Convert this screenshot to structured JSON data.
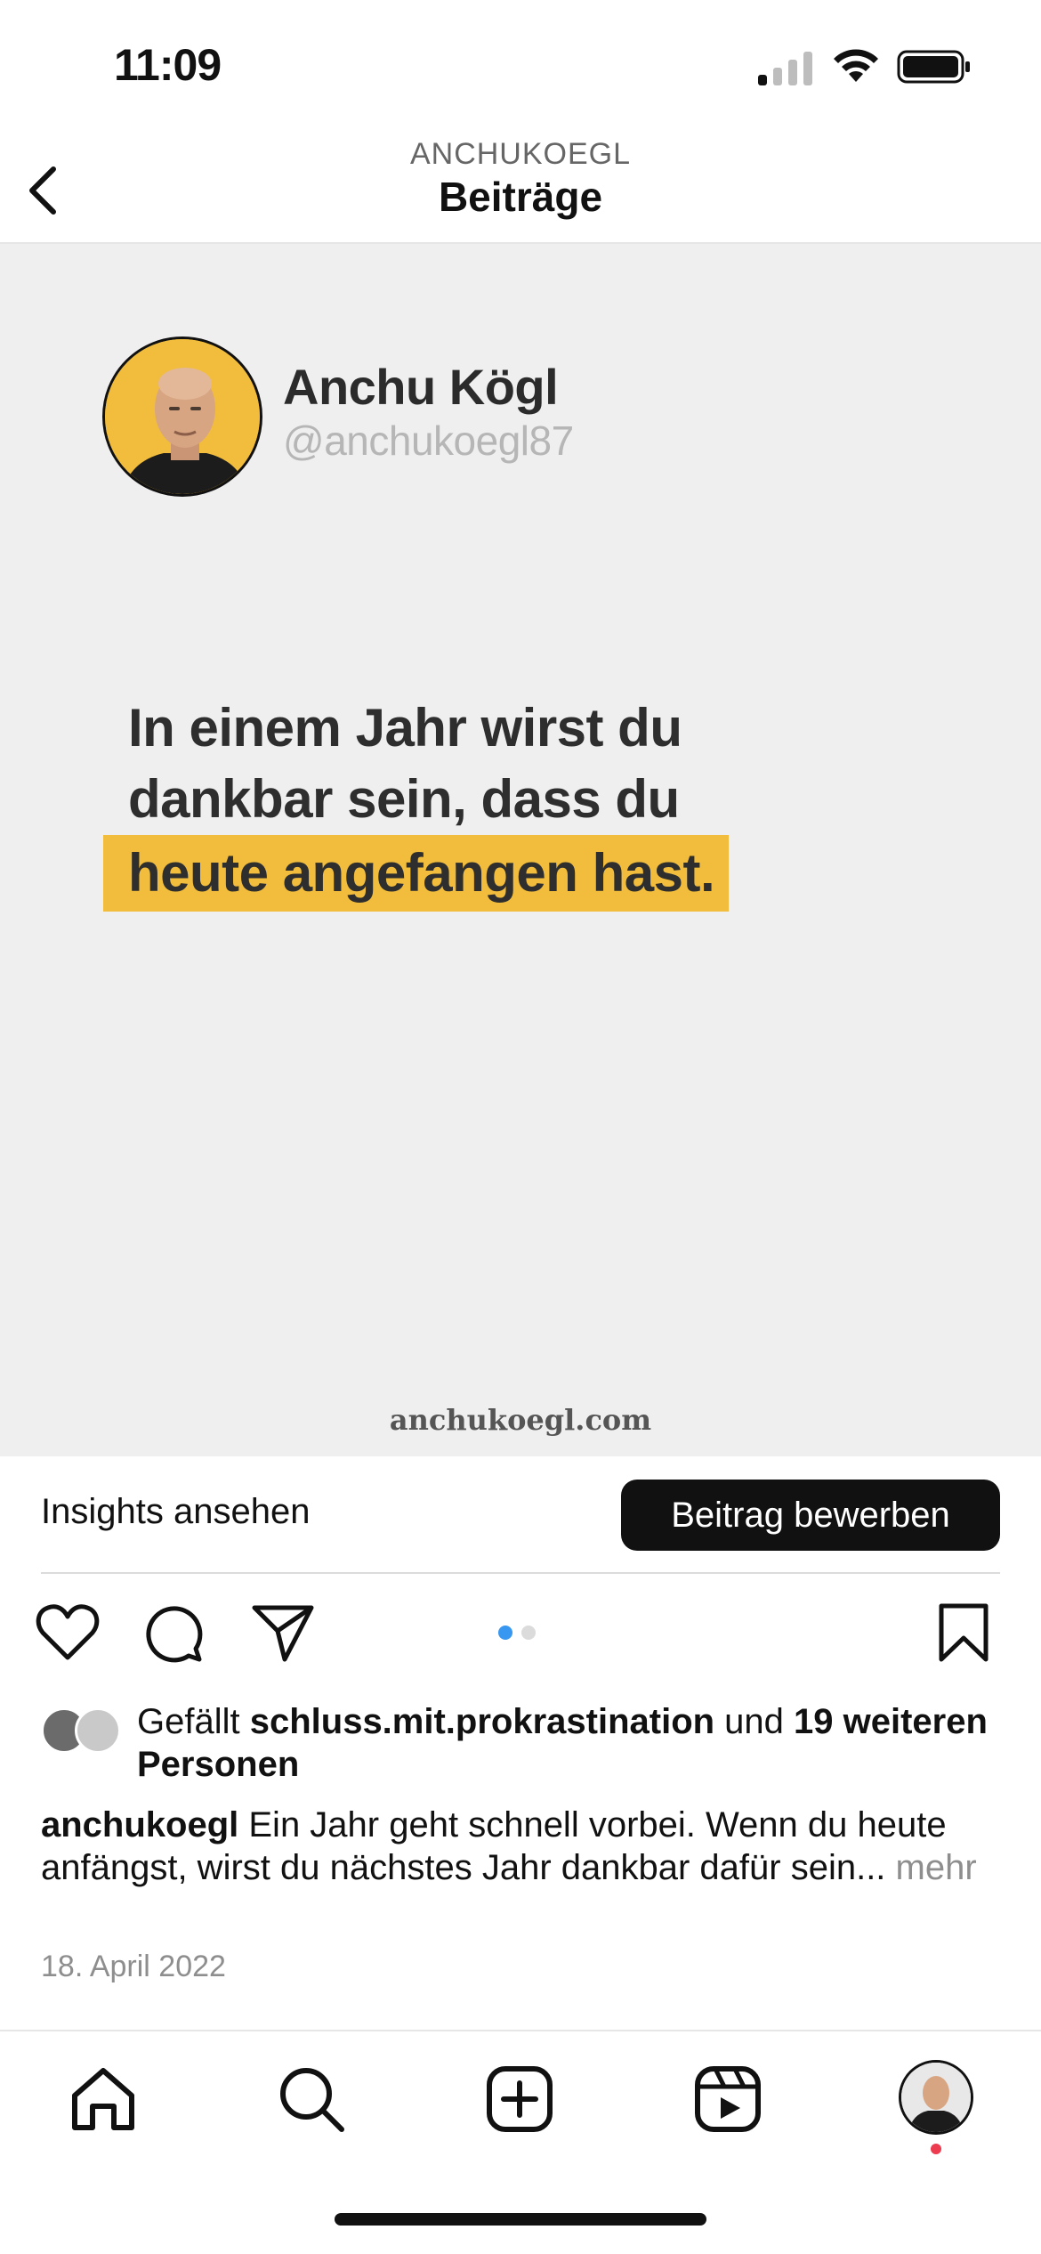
{
  "status_bar": {
    "time": "11:09"
  },
  "header": {
    "username": "ANCHUKOEGL",
    "title": "Beiträge"
  },
  "post": {
    "author_name": "Anchu Kögl",
    "author_handle": "@anchukoegl87",
    "quote_line_1": "In einem Jahr wirst du",
    "quote_line_2": "dankbar sein, dass du",
    "quote_line_3": "heute angefangen hast.",
    "watermark": "anchukoegl.com",
    "accent_color": "#f2bd3c",
    "background_color": "#efefef"
  },
  "insights": {
    "link_label": "Insights ansehen",
    "promote_label": "Beitrag bewerben"
  },
  "carousel": {
    "total": 2,
    "active_index": 0,
    "active_color": "#3897f0",
    "inactive_color": "#dbdbdb"
  },
  "likes": {
    "prefix": "Gefällt ",
    "liker": "schluss.mit.prokrastination",
    "connector": " und ",
    "others": "19 weiteren Personen"
  },
  "caption": {
    "username": "anchukoegl",
    "text": " Ein Jahr geht schnell vorbei. Wenn du heute anfängst, wirst du nächstes Jahr dankbar dafür sein...",
    "more": " mehr"
  },
  "date": "18. April 2022",
  "icons": {
    "back": "chevron-left-icon",
    "like": "heart-icon",
    "comment": "comment-icon",
    "share": "paper-plane-icon",
    "save": "bookmark-icon",
    "nav": [
      "home-icon",
      "search-icon",
      "create-icon",
      "reels-icon",
      "profile-avatar"
    ]
  }
}
